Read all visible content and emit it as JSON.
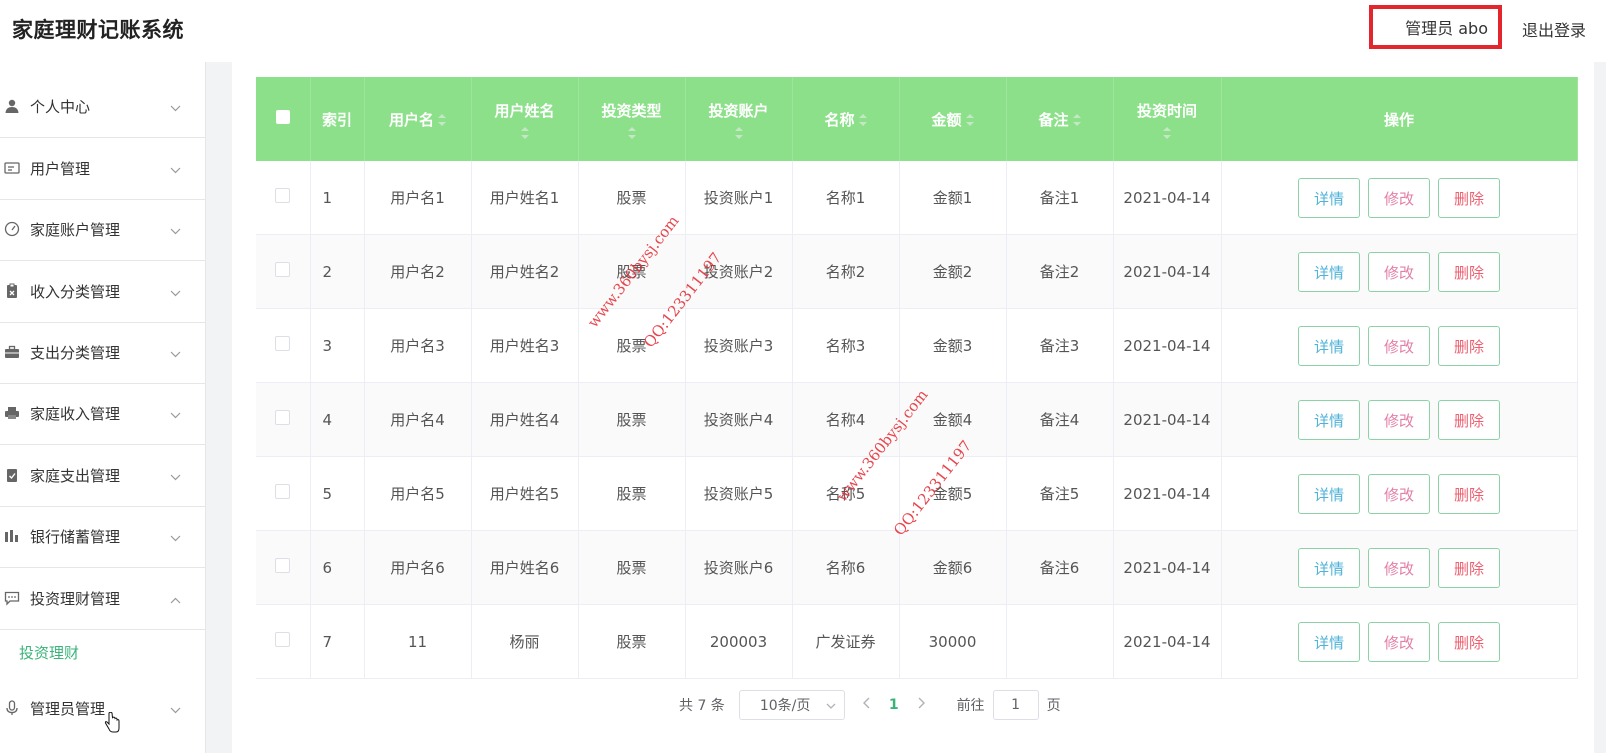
{
  "header": {
    "app_title": "家庭理财记账系统",
    "admin_label": "管理员 abo",
    "logout_label": "退出登录"
  },
  "sidebar": {
    "items": [
      {
        "label": "个人中心",
        "icon": "user-icon"
      },
      {
        "label": "用户管理",
        "icon": "id-card-icon"
      },
      {
        "label": "家庭账户管理",
        "icon": "gauge-icon"
      },
      {
        "label": "收入分类管理",
        "icon": "clipboard-icon"
      },
      {
        "label": "支出分类管理",
        "icon": "briefcase-icon"
      },
      {
        "label": "家庭收入管理",
        "icon": "printer-icon"
      },
      {
        "label": "家庭支出管理",
        "icon": "checklist-icon"
      },
      {
        "label": "银行储蓄管理",
        "icon": "bar-chart-icon"
      },
      {
        "label": "投资理财管理",
        "icon": "chat-icon"
      },
      {
        "label": "管理员管理",
        "icon": "microphone-icon"
      }
    ],
    "active_sub": "投资理财"
  },
  "table": {
    "headers": [
      "索引",
      "用户名",
      "用户姓名",
      "投资类型",
      "投资账户",
      "名称",
      "金额",
      "备注",
      "投资时间",
      "操作"
    ],
    "actions": {
      "detail": "详情",
      "edit": "修改",
      "delete": "删除"
    },
    "rows": [
      [
        "1",
        "用户名1",
        "用户姓名1",
        "股票",
        "投资账户1",
        "名称1",
        "金额1",
        "备注1",
        "2021-04-14"
      ],
      [
        "2",
        "用户名2",
        "用户姓名2",
        "股票",
        "投资账户2",
        "名称2",
        "金额2",
        "备注2",
        "2021-04-14"
      ],
      [
        "3",
        "用户名3",
        "用户姓名3",
        "股票",
        "投资账户3",
        "名称3",
        "金额3",
        "备注3",
        "2021-04-14"
      ],
      [
        "4",
        "用户名4",
        "用户姓名4",
        "股票",
        "投资账户4",
        "名称4",
        "金额4",
        "备注4",
        "2021-04-14"
      ],
      [
        "5",
        "用户名5",
        "用户姓名5",
        "股票",
        "投资账户5",
        "名称5",
        "金额5",
        "备注5",
        "2021-04-14"
      ],
      [
        "6",
        "用户名6",
        "用户姓名6",
        "股票",
        "投资账户6",
        "名称6",
        "金额6",
        "备注6",
        "2021-04-14"
      ],
      [
        "7",
        "11",
        "杨丽",
        "股票",
        "200003",
        "广发证券",
        "30000",
        "",
        "2021-04-14"
      ]
    ]
  },
  "pagination": {
    "total": "共 7 条",
    "page_size": "10条/页",
    "current": "1",
    "goto_label": "前往",
    "goto_value": "1",
    "page_suffix": "页"
  },
  "watermarks": [
    {
      "site": "www.360bysj.com",
      "qq": "QQ:123311197"
    },
    {
      "site": "www.360bysj.com",
      "qq": "QQ:123311197"
    }
  ],
  "colors": {
    "header_green": "#8ce08a",
    "accent_green": "#3ab37a",
    "highlight_red": "#e3262e"
  }
}
